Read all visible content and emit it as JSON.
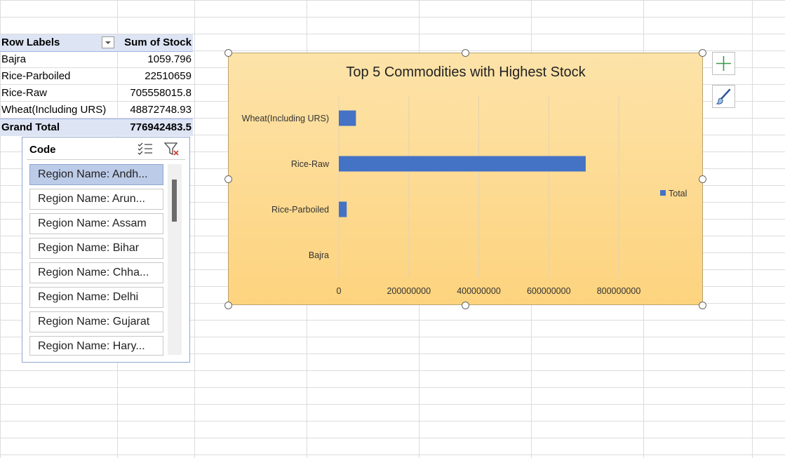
{
  "pivot": {
    "header": {
      "row_labels": "Row Labels",
      "sum_label": "Sum of Stock"
    },
    "rows": [
      {
        "label": "Bajra",
        "value": "1059.796"
      },
      {
        "label": "Rice-Parboiled",
        "value": "22510659"
      },
      {
        "label": "Rice-Raw",
        "value": "705558015.8"
      },
      {
        "label": "Wheat(Including URS)",
        "value": "48872748.93"
      }
    ],
    "total": {
      "label": "Grand Total",
      "value": "776942483.5"
    }
  },
  "slicer": {
    "title": "Code",
    "items": [
      "Region Name: Andh...",
      "Region Name: Arun...",
      "Region Name: Assam",
      "Region Name: Bihar",
      "Region Name: Chha...",
      "Region Name: Delhi",
      "Region Name: Gujarat",
      "Region Name: Hary..."
    ],
    "selected_index": 0
  },
  "chart_data": {
    "type": "bar",
    "orientation": "horizontal",
    "title": "Top 5 Commodities with Highest Stock",
    "categories": [
      "Bajra",
      "Rice-Parboiled",
      "Rice-Raw",
      "Wheat(Including URS)"
    ],
    "series": [
      {
        "name": "Total",
        "values": [
          1059.796,
          22510659,
          705558015.8,
          48872748.93
        ]
      }
    ],
    "xlim": [
      0,
      800000000
    ],
    "x_ticks": [
      "0",
      "200000000",
      "400000000",
      "600000000",
      "800000000"
    ],
    "legend": "right",
    "grid": true,
    "bar_color": "#4472c4"
  },
  "colors": {
    "chart_bg_top": "#fde3a9",
    "chart_bg_bottom": "#fdd37e",
    "pivot_header": "#dde4f4",
    "slicer_selected": "#bccbe8"
  },
  "icons": {
    "chart_elements": "plus-icon",
    "chart_styles": "brush-icon",
    "multi_select": "multi-select-icon",
    "clear_filter": "clear-filter-icon"
  }
}
